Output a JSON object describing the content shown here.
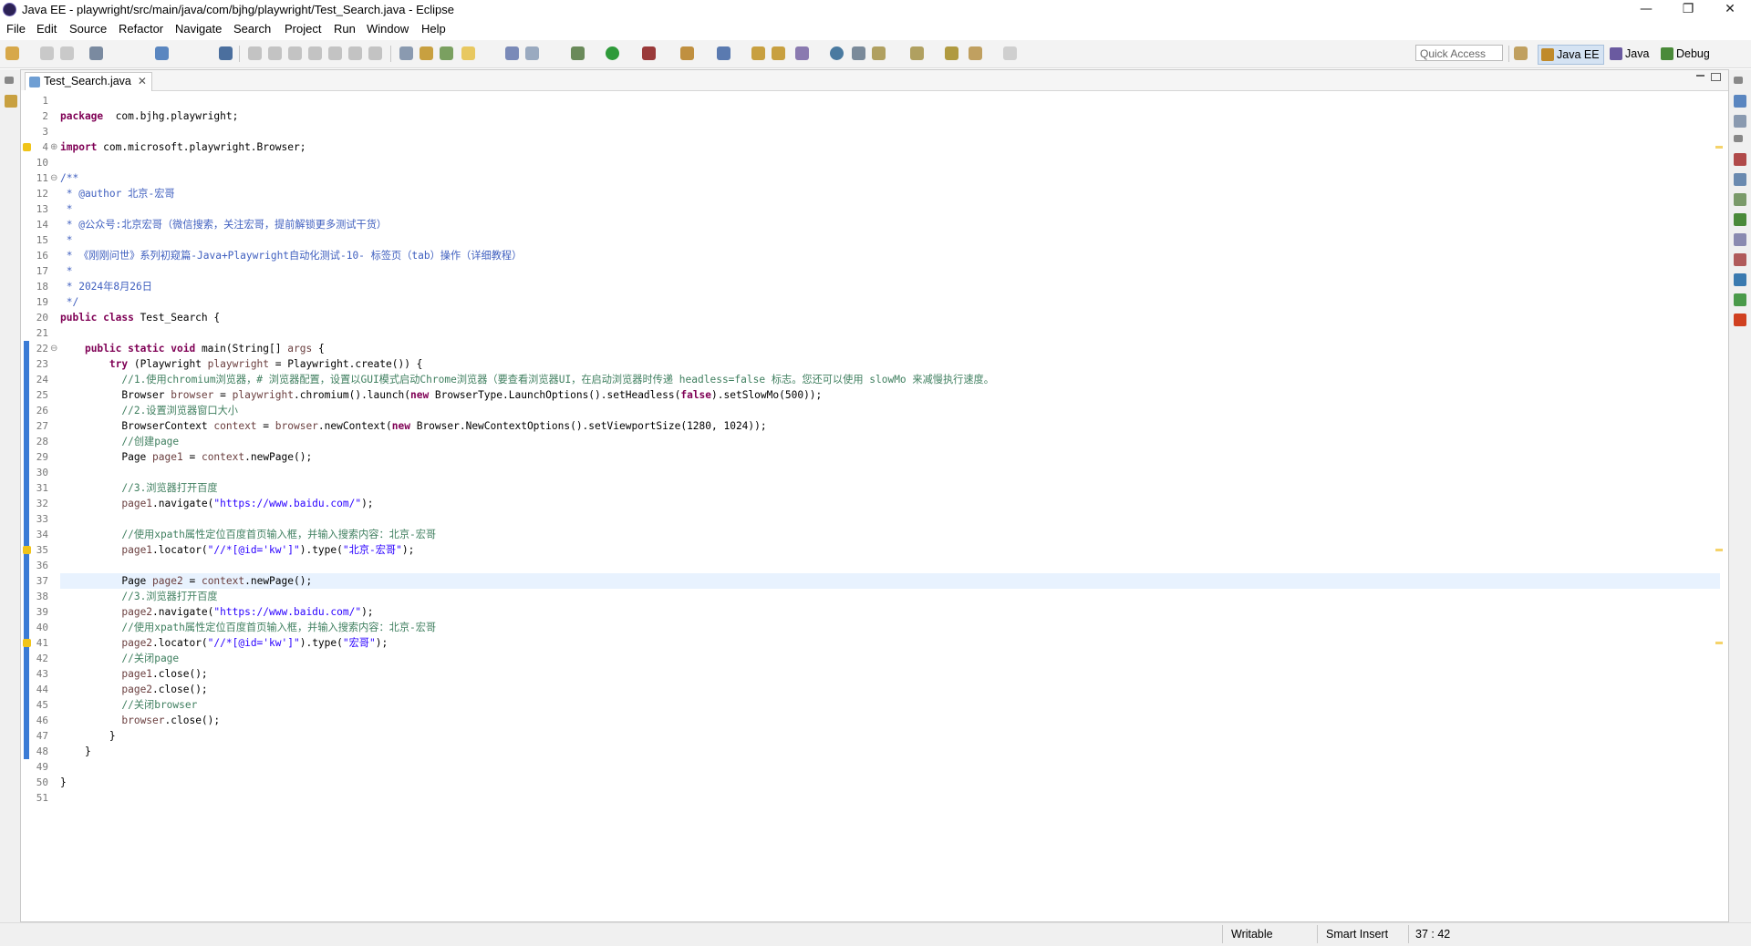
{
  "window": {
    "title": "Java EE - playwright/src/main/java/com/bjhg/playwright/Test_Search.java - Eclipse",
    "min": "—",
    "restore": "❐",
    "close": "✕"
  },
  "menu": [
    "File",
    "Edit",
    "Source",
    "Refactor",
    "Navigate",
    "Search",
    "Project",
    "Run",
    "Window",
    "Help"
  ],
  "toolbar": {
    "quick_access_placeholder": "Quick Access"
  },
  "perspectives": [
    {
      "label": "Java EE",
      "active": true,
      "color": "#c08a2a"
    },
    {
      "label": "Java",
      "active": false,
      "color": "#6a5aa0"
    },
    {
      "label": "Debug",
      "active": false,
      "color": "#4a8a3a"
    }
  ],
  "editor": {
    "tab_title": "Test_Search.java",
    "tab_close": "✕",
    "lines": [
      {
        "n": "1",
        "t": []
      },
      {
        "n": "2",
        "t": [
          [
            "kw",
            "package"
          ],
          [
            "",
            "  com.bjhg.playwright;"
          ]
        ]
      },
      {
        "n": "3",
        "t": []
      },
      {
        "n": "4",
        "t": [
          [
            "kw",
            "import"
          ],
          [
            "",
            " com.microsoft.playwright.Browser;"
          ]
        ]
      },
      {
        "n": "10",
        "t": []
      },
      {
        "n": "11",
        "t": [
          [
            "jd",
            "/**"
          ]
        ]
      },
      {
        "n": "12",
        "t": [
          [
            "jd",
            " * @author 北京-宏哥"
          ]
        ]
      },
      {
        "n": "13",
        "t": [
          [
            "jd",
            " *"
          ]
        ]
      },
      {
        "n": "14",
        "t": [
          [
            "jd",
            " * @公众号:北京宏哥（微信搜索，关注宏哥，提前解锁更多测试干货）"
          ]
        ]
      },
      {
        "n": "15",
        "t": [
          [
            "jd",
            " *"
          ]
        ]
      },
      {
        "n": "16",
        "t": [
          [
            "jd",
            " * 《刚刚问世》系列初窥篇-Java+Playwright自动化测试-10- 标签页（tab）操作（详细教程）"
          ]
        ]
      },
      {
        "n": "17",
        "t": [
          [
            "jd",
            " *"
          ]
        ]
      },
      {
        "n": "18",
        "t": [
          [
            "jd",
            " * 2024年8月26日"
          ]
        ]
      },
      {
        "n": "19",
        "t": [
          [
            "jd",
            " */"
          ]
        ]
      },
      {
        "n": "20",
        "t": [
          [
            "kw",
            "public class"
          ],
          [
            "",
            " Test_Search {"
          ]
        ]
      },
      {
        "n": "21",
        "t": []
      },
      {
        "n": "22",
        "t": [
          [
            "",
            "    "
          ],
          [
            "kw",
            "public static void"
          ],
          [
            "",
            " main(String[] "
          ],
          [
            "var",
            "args"
          ],
          [
            "",
            " {"
          ]
        ]
      },
      {
        "n": "23",
        "t": [
          [
            "",
            "        "
          ],
          [
            "kw",
            "try"
          ],
          [
            "",
            " (Playwright "
          ],
          [
            "var",
            "playwright"
          ],
          [
            "",
            " = Playwright.create()) {"
          ]
        ]
      },
      {
        "n": "24",
        "t": [
          [
            "",
            "          "
          ],
          [
            "cm",
            "//1.使用chromium浏览器，# 浏览器配置，设置以GUI模式启动Chrome浏览器（要查看浏览器UI，在启动浏览器时传递 headless=false 标志。您还可以使用 slowMo 来减慢执行速度。"
          ]
        ]
      },
      {
        "n": "25",
        "t": [
          [
            "",
            "          Browser "
          ],
          [
            "var",
            "browser"
          ],
          [
            "",
            " = "
          ],
          [
            "var",
            "playwright"
          ],
          [
            "",
            ".chromium().launch("
          ],
          [
            "kw",
            "new"
          ],
          [
            "",
            " BrowserType.LaunchOptions().setHeadless("
          ],
          [
            "kw",
            "false"
          ],
          [
            "",
            ").setSlowMo(500));"
          ]
        ]
      },
      {
        "n": "26",
        "t": [
          [
            "",
            "          "
          ],
          [
            "cm",
            "//2.设置浏览器窗口大小"
          ]
        ]
      },
      {
        "n": "27",
        "t": [
          [
            "",
            "          BrowserContext "
          ],
          [
            "var",
            "context"
          ],
          [
            "",
            " = "
          ],
          [
            "var",
            "browser"
          ],
          [
            "",
            ".newContext("
          ],
          [
            "kw",
            "new"
          ],
          [
            "",
            " Browser.NewContextOptions().setViewportSize(1280, 1024));"
          ]
        ]
      },
      {
        "n": "28",
        "t": [
          [
            "",
            "          "
          ],
          [
            "cm",
            "//创建page"
          ]
        ]
      },
      {
        "n": "29",
        "t": [
          [
            "",
            "          Page "
          ],
          [
            "var",
            "page1"
          ],
          [
            "",
            " = "
          ],
          [
            "var",
            "context"
          ],
          [
            "",
            ".newPage();"
          ]
        ]
      },
      {
        "n": "30",
        "t": []
      },
      {
        "n": "31",
        "t": [
          [
            "",
            "          "
          ],
          [
            "cm",
            "//3.浏览器打开百度"
          ]
        ]
      },
      {
        "n": "32",
        "t": [
          [
            "",
            "          "
          ],
          [
            "var",
            "page1"
          ],
          [
            "",
            ".navigate("
          ],
          [
            "st",
            "\"https://www.baidu.com/\""
          ],
          [
            "",
            ");"
          ]
        ]
      },
      {
        "n": "33",
        "t": []
      },
      {
        "n": "34",
        "t": [
          [
            "",
            "          "
          ],
          [
            "cm",
            "//使用xpath属性定位百度首页输入框，并输入搜索内容：北京-宏哥"
          ]
        ]
      },
      {
        "n": "35",
        "t": [
          [
            "",
            "          "
          ],
          [
            "var",
            "page1"
          ],
          [
            "",
            ".locator("
          ],
          [
            "st",
            "\"//*[@id='kw']\""
          ],
          [
            "",
            ").type("
          ],
          [
            "st",
            "\"北京-宏哥\""
          ],
          [
            "",
            ");"
          ]
        ]
      },
      {
        "n": "36",
        "t": []
      },
      {
        "n": "37",
        "t": [
          [
            "",
            "          Page "
          ],
          [
            "var",
            "page2"
          ],
          [
            "",
            " = "
          ],
          [
            "var",
            "context"
          ],
          [
            "",
            ".newPage();"
          ]
        ]
      },
      {
        "n": "38",
        "t": [
          [
            "",
            "          "
          ],
          [
            "cm",
            "//3.浏览器打开百度"
          ]
        ]
      },
      {
        "n": "39",
        "t": [
          [
            "",
            "          "
          ],
          [
            "var",
            "page2"
          ],
          [
            "",
            ".navigate("
          ],
          [
            "st",
            "\"https://www.baidu.com/\""
          ],
          [
            "",
            ");"
          ]
        ]
      },
      {
        "n": "40",
        "t": [
          [
            "",
            "          "
          ],
          [
            "cm",
            "//使用xpath属性定位百度首页输入框，并输入搜索内容：北京-宏哥"
          ]
        ]
      },
      {
        "n": "41",
        "t": [
          [
            "",
            "          "
          ],
          [
            "var",
            "page2"
          ],
          [
            "",
            ".locator("
          ],
          [
            "st",
            "\"//*[@id='kw']\""
          ],
          [
            "",
            ").type("
          ],
          [
            "st",
            "\"宏哥\""
          ],
          [
            "",
            ");"
          ]
        ]
      },
      {
        "n": "42",
        "t": [
          [
            "",
            "          "
          ],
          [
            "cm",
            "//关闭page"
          ]
        ]
      },
      {
        "n": "43",
        "t": [
          [
            "",
            "          "
          ],
          [
            "var",
            "page1"
          ],
          [
            "",
            ".close();"
          ]
        ]
      },
      {
        "n": "44",
        "t": [
          [
            "",
            "          "
          ],
          [
            "var",
            "page2"
          ],
          [
            "",
            ".close();"
          ]
        ]
      },
      {
        "n": "45",
        "t": [
          [
            "",
            "          "
          ],
          [
            "cm",
            "//关闭browser"
          ]
        ]
      },
      {
        "n": "46",
        "t": [
          [
            "",
            "          "
          ],
          [
            "var",
            "browser"
          ],
          [
            "",
            ".close();"
          ]
        ]
      },
      {
        "n": "47",
        "t": [
          [
            "",
            "        }"
          ]
        ]
      },
      {
        "n": "48",
        "t": [
          [
            "",
            "    }"
          ]
        ]
      },
      {
        "n": "49",
        "t": []
      },
      {
        "n": "50",
        "t": [
          [
            "",
            "}"
          ]
        ]
      },
      {
        "n": "51",
        "t": []
      }
    ]
  },
  "status": {
    "writable": "Writable",
    "insert_mode": "Smart Insert",
    "position": "37 : 42"
  }
}
